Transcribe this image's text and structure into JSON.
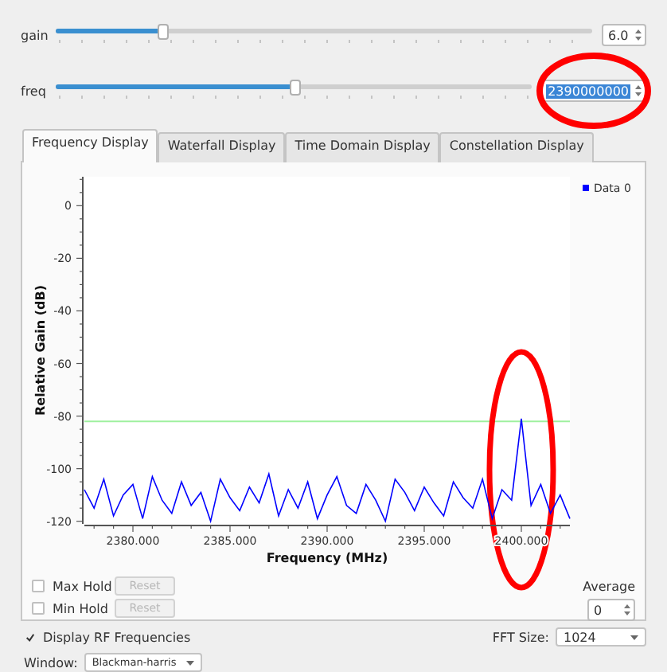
{
  "controls": [
    {
      "label": "gain",
      "level": 0.2,
      "value": "6.0",
      "text_selected": false,
      "circled": false
    },
    {
      "label": "freq",
      "level": 0.5,
      "value": "2390000000",
      "text_selected": true,
      "circled": true
    }
  ],
  "tabs": [
    {
      "label": "Frequency Display",
      "selected": true
    },
    {
      "label": "Waterfall Display",
      "selected": false
    },
    {
      "label": "Time Domain Display",
      "selected": false
    },
    {
      "label": "Constellation Display",
      "selected": false
    }
  ],
  "chart_data": {
    "type": "line",
    "xlabel": "Frequency (MHz)",
    "ylabel": "Relative Gain (dB)",
    "xlim": [
      2377.5,
      2402.5
    ],
    "ylim": [
      -121,
      11
    ],
    "xticks": [
      {
        "value": 2380,
        "label": "2380.000"
      },
      {
        "value": 2385,
        "label": "2385.000"
      },
      {
        "value": 2390,
        "label": "2390.000"
      },
      {
        "value": 2395,
        "label": "2395.000"
      },
      {
        "value": 2400,
        "label": "2400.000"
      }
    ],
    "yticks": [
      -120,
      -100,
      -80,
      -60,
      -40,
      -20,
      0
    ],
    "x": [
      2377.5,
      2378,
      2378.5,
      2379,
      2379.5,
      2380,
      2380.5,
      2381,
      2381.5,
      2382,
      2382.5,
      2383,
      2383.5,
      2384,
      2384.5,
      2385,
      2385.5,
      2386,
      2386.5,
      2387,
      2387.5,
      2388,
      2388.5,
      2389,
      2389.5,
      2390,
      2390.5,
      2391,
      2391.5,
      2392,
      2392.5,
      2393,
      2393.5,
      2394,
      2394.5,
      2395,
      2395.5,
      2396,
      2396.5,
      2397,
      2397.5,
      2398,
      2398.5,
      2399,
      2399.5,
      2400,
      2400.5,
      2401,
      2401.5,
      2402,
      2402.5
    ],
    "series": [
      {
        "name": "Data 0",
        "color": "#0000ff",
        "values": [
          -108,
          -115,
          -104,
          -118,
          -110,
          -106,
          -119,
          -103,
          -112,
          -117,
          -105,
          -114,
          -109,
          -120,
          -104,
          -111,
          -116,
          -107,
          -113,
          -102,
          -118,
          -108,
          -115,
          -105,
          -119,
          -110,
          -103,
          -114,
          -117,
          -106,
          -112,
          -120,
          -104,
          -109,
          -116,
          -107,
          -113,
          -118,
          -105,
          -111,
          -115,
          -104,
          -119,
          -108,
          -112,
          -81,
          -114,
          -106,
          -117,
          -110,
          -119
        ]
      }
    ],
    "ref_lines": [
      {
        "axis": "y",
        "value": -82,
        "color": "#9ff09f"
      }
    ]
  },
  "peak_circled": true,
  "hold": [
    {
      "label": "Max Hold",
      "checked": false,
      "button": "Reset",
      "disabled": true
    },
    {
      "label": "Min Hold",
      "checked": false,
      "button": "Reset",
      "disabled": true
    }
  ],
  "average": {
    "label": "Average",
    "value": "0"
  },
  "display_rf": {
    "label": "Display RF Frequencies",
    "checked": true
  },
  "fft_size": {
    "label": "FFT Size:",
    "value": "1024"
  },
  "window": {
    "label": "Window:",
    "value": "Blackman-harris"
  }
}
